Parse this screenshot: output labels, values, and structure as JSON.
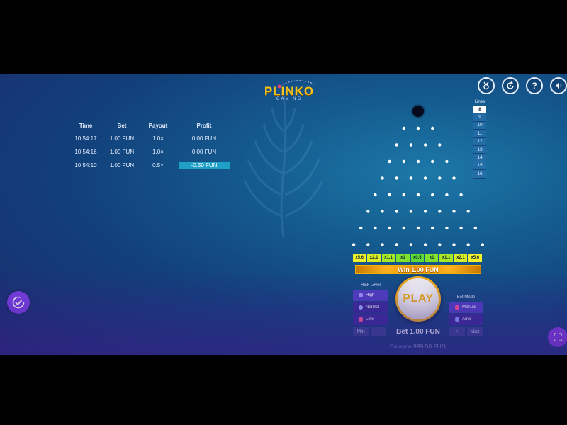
{
  "logo": {
    "title": "PLINKO",
    "subtitle": "GAMING"
  },
  "history": {
    "headers": [
      "Time",
      "Bet",
      "Payout",
      "Profit"
    ],
    "rows": [
      {
        "time": "10:54:17",
        "bet": "1.00 FUN",
        "payout": "1.0×",
        "profit": "0.00 FUN"
      },
      {
        "time": "10:54:16",
        "bet": "1.00 FUN",
        "payout": "1.0×",
        "profit": "0.00 FUN"
      },
      {
        "time": "10:54:10",
        "bet": "1.00 FUN",
        "payout": "0.5×",
        "profit": "-0.50 FUN"
      }
    ]
  },
  "top_icons": [
    "medal-icon",
    "refresh-icon",
    "help-icon",
    "sound-icon"
  ],
  "help_label": "?",
  "lines": {
    "title": "Lines",
    "options": [
      "8",
      "9",
      "10",
      "11",
      "12",
      "13",
      "14",
      "15",
      "16"
    ],
    "selected": "8"
  },
  "board": {
    "rows": 8
  },
  "multipliers": [
    {
      "label": "x5.6",
      "color": "#f3f22a"
    },
    {
      "label": "x2.1",
      "color": "#d9ef23"
    },
    {
      "label": "x1.1",
      "color": "#a9e827"
    },
    {
      "label": "x1",
      "color": "#7fe12c"
    },
    {
      "label": "x0.5",
      "color": "#5fdc34"
    },
    {
      "label": "x1",
      "color": "#7fe12c"
    },
    {
      "label": "x1.1",
      "color": "#a9e827"
    },
    {
      "label": "x2.1",
      "color": "#d9ef23"
    },
    {
      "label": "x5.6",
      "color": "#f3f22a"
    }
  ],
  "win_banner": "Win 1.00 FUN",
  "risk": {
    "title": "Risk Level",
    "options": [
      "High",
      "Normal",
      "Low"
    ],
    "selected": "High"
  },
  "bet_mode": {
    "title": "Bet Mode",
    "options": [
      "Manual",
      "Auto"
    ],
    "selected": "Manual"
  },
  "play_label": "PLAY",
  "bet": {
    "min": "Min",
    "minus": "−",
    "label": "Bet 1.00 FUN",
    "plus": "+",
    "max": "Max"
  },
  "balance": "Balance 999.50 FUN",
  "colors": {
    "accent_purple": "#7b3fe4",
    "gold": "#f6b414",
    "profit_negative_bg": "#1fa0c7"
  }
}
